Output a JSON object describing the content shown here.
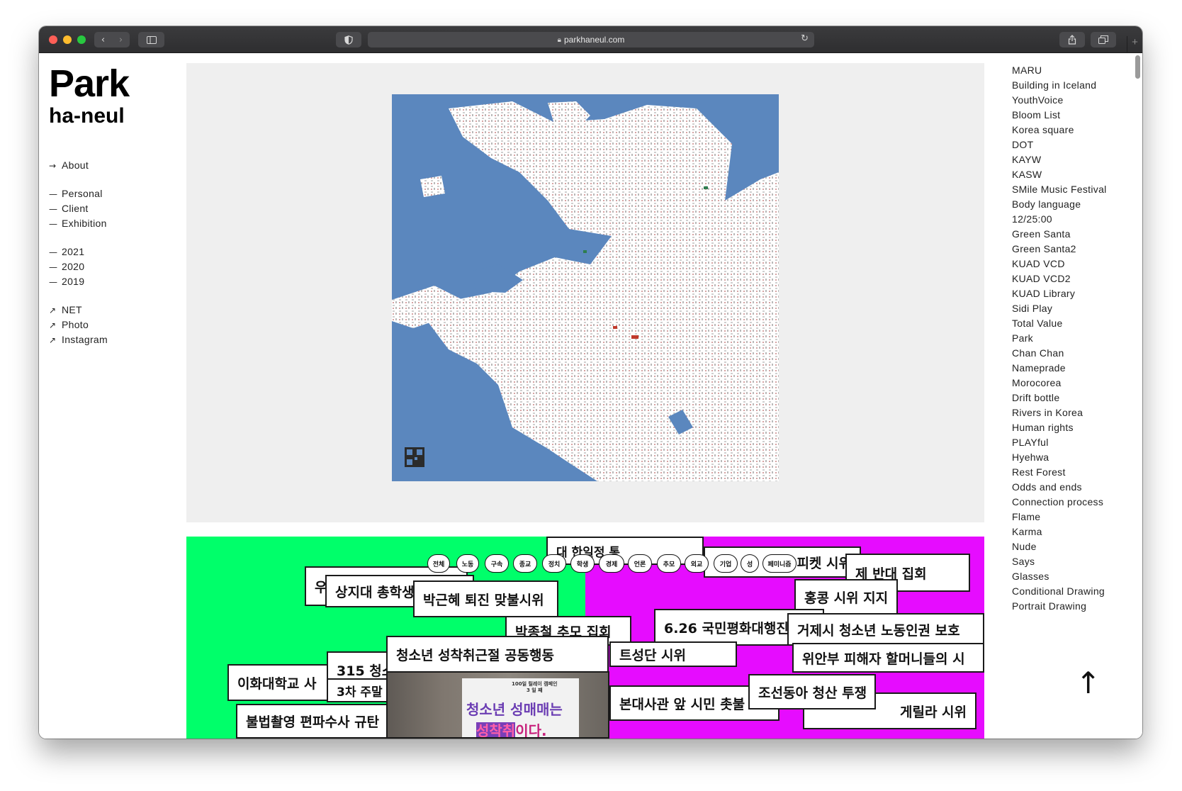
{
  "browser": {
    "url": "parkhaneul.com",
    "nav_back_icon": "chevron-left-icon",
    "nav_forward_icon": "chevron-right-icon"
  },
  "brand": {
    "line1": "Park",
    "line2": "ha-neul"
  },
  "left_nav": {
    "about": {
      "mark": "→",
      "label": "About"
    },
    "categories": [
      {
        "mark": "—",
        "label": "Personal"
      },
      {
        "mark": "—",
        "label": "Client"
      },
      {
        "mark": "—",
        "label": "Exhibition"
      }
    ],
    "years": [
      {
        "mark": "—",
        "label": "2021"
      },
      {
        "mark": "—",
        "label": "2020"
      },
      {
        "mark": "—",
        "label": "2019"
      }
    ],
    "external": [
      {
        "mark": "↗",
        "label": "NET"
      },
      {
        "mark": "↗",
        "label": "Photo"
      },
      {
        "mark": "↗",
        "label": "Instagram"
      }
    ]
  },
  "projects": [
    "MARU",
    "Building in Iceland",
    "YouthVoice",
    "Bloom List",
    "Korea square",
    "DOT",
    "KAYW",
    "KASW",
    "SMile Music Festival",
    "Body language",
    "12/25:00",
    "Green Santa",
    "Green Santa2",
    "KUAD VCD",
    "KUAD VCD2",
    "KUAD Library",
    "Sidi Play",
    "Total Value",
    "Park",
    "Chan Chan",
    "Nameprade",
    "Morocorea",
    "Drift bottle",
    "Rivers in Korea",
    "Human rights",
    "PLAYful",
    "Hyehwa",
    "Rest Forest",
    "Odds and ends",
    "Connection process",
    "Flame",
    "Karma",
    "Nude",
    "Says",
    "Glasses",
    "Conditional Drawing",
    "Portrait Drawing"
  ],
  "protest": {
    "filters": [
      "전체",
      "노동",
      "구속",
      "종교",
      "정치",
      "학생",
      "경제",
      "언론",
      "추모",
      "외교",
      "기업",
      "성",
      "페미니즘"
    ],
    "cards": [
      "우",
      "상지대 총학생",
      "박근혜 퇴진 맞불시위",
      "대 한일정 통",
      "피켓 시위",
      "제 반대 집회",
      "홍콩 시위 지지",
      "박종철 추모 집회",
      "6.26 국민평화대행진",
      "거제시 청소년 노동인권 보호",
      "청소년 성착취근절 공동행동",
      "315 청소",
      "3차 주말",
      "이화대학교 사",
      "위안부 피해자 할머니들의 시",
      "불법촬영 편파수사 규탄",
      "본대사관 앞 시민 촛불",
      "조선동아 청산 투쟁",
      "게릴라 시위",
      "트성단 시위"
    ],
    "photo_sign": {
      "small_top": "100일 릴레이 캠페인",
      "small_sub": "3 일 째",
      "line1a": "청소년",
      "line1b": "성매매는",
      "line2a": "성착취",
      "line2b": "이다."
    }
  },
  "back_to_top": "↑"
}
